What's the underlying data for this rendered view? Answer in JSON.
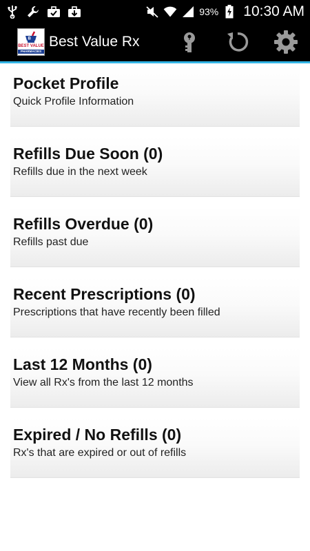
{
  "status_bar": {
    "icons_left": [
      "usb-icon",
      "wrench-icon",
      "briefcase-check-icon",
      "briefcase-download-icon"
    ],
    "icons_right": [
      "mute-icon",
      "wifi-icon",
      "signal-icon",
      "battery-charging-icon"
    ],
    "battery": "93%",
    "time": "10:30 AM"
  },
  "action_bar": {
    "title": "Best Value Rx",
    "logo": {
      "line1": "BEST VALUE",
      "line2": "PHARMACIES"
    },
    "actions": [
      "key-icon",
      "refresh-icon",
      "gear-icon"
    ]
  },
  "menu": [
    {
      "title": "Pocket Profile",
      "subtitle": "Quick Profile Information"
    },
    {
      "title": "Refills Due Soon (0)",
      "subtitle": "Refills due in the next week"
    },
    {
      "title": "Refills Overdue (0)",
      "subtitle": "Refills past due"
    },
    {
      "title": "Recent Prescriptions (0)",
      "subtitle": "Prescriptions that have recently been filled"
    },
    {
      "title": "Last 12 Months (0)",
      "subtitle": "View all Rx's from the last 12 months"
    },
    {
      "title": "Expired / No Refills (0)",
      "subtitle": "Rx's that are expired or out of refills"
    }
  ],
  "colors": {
    "accent": "#33b5e5",
    "bar_bg": "#000000",
    "icon_gray": "#9a9a9a"
  }
}
